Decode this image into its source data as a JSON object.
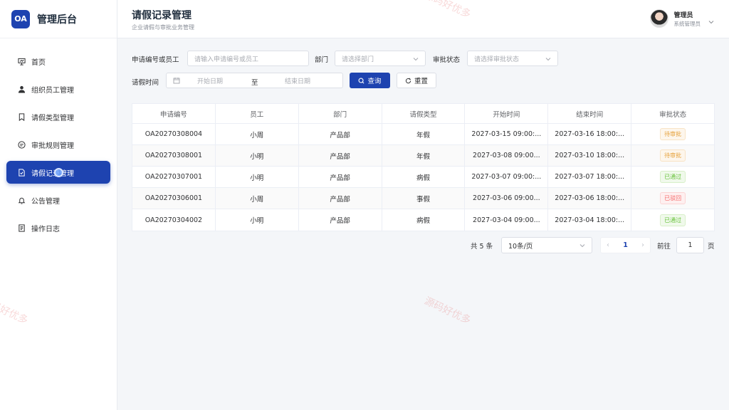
{
  "brand": {
    "logo_text": "OA",
    "name": "管理后台"
  },
  "sidebar": {
    "items": [
      {
        "label": "首页",
        "icon": "presentation-icon",
        "active": false
      },
      {
        "label": "组织员工管理",
        "icon": "user-icon",
        "active": false
      },
      {
        "label": "请假类型管理",
        "icon": "bookmark-icon",
        "active": false
      },
      {
        "label": "审批规则管理",
        "icon": "rules-icon",
        "active": false
      },
      {
        "label": "请假记录管理",
        "icon": "document-icon",
        "active": true
      },
      {
        "label": "公告管理",
        "icon": "bell-icon",
        "active": false
      },
      {
        "label": "操作日志",
        "icon": "log-icon",
        "active": false
      }
    ]
  },
  "header": {
    "title": "请假记录管理",
    "subtitle": "企业请假与审批业务管理",
    "user": {
      "name": "管理员",
      "role": "系统管理员"
    }
  },
  "filters": {
    "keyword_label": "申请编号或员工",
    "keyword_placeholder": "请输入申请编号或员工",
    "dept_label": "部门",
    "dept_placeholder": "请选择部门",
    "status_label": "审批状态",
    "status_placeholder": "请选择审批状态",
    "time_label": "请假时间",
    "start_placeholder": "开始日期",
    "range_sep": "至",
    "end_placeholder": "结束日期",
    "search_button": "查询",
    "reset_button": "重置"
  },
  "table": {
    "columns": [
      "申请编号",
      "员工",
      "部门",
      "请假类型",
      "开始时间",
      "结束时间",
      "审批状态"
    ],
    "rows": [
      {
        "id": "OA20270308004",
        "employee": "小周",
        "dept": "产品部",
        "type": "年假",
        "start": "2027-03-15 09:00:...",
        "end": "2027-03-16 18:00:...",
        "status": "待审批",
        "status_kind": "pending"
      },
      {
        "id": "OA20270308001",
        "employee": "小明",
        "dept": "产品部",
        "type": "年假",
        "start": "2027-03-08 09:00...",
        "end": "2027-03-10 18:00:...",
        "status": "待审批",
        "status_kind": "pending"
      },
      {
        "id": "OA20270307001",
        "employee": "小明",
        "dept": "产品部",
        "type": "病假",
        "start": "2027-03-07 09:00:...",
        "end": "2027-03-07 18:00:...",
        "status": "已通过",
        "status_kind": "approved"
      },
      {
        "id": "OA20270306001",
        "employee": "小周",
        "dept": "产品部",
        "type": "事假",
        "start": "2027-03-06 09:00...",
        "end": "2027-03-06 18:00:...",
        "status": "已驳回",
        "status_kind": "rejected"
      },
      {
        "id": "OA20270304002",
        "employee": "小明",
        "dept": "产品部",
        "type": "病假",
        "start": "2027-03-04 09:00...",
        "end": "2027-03-04 18:00:...",
        "status": "已通过",
        "status_kind": "approved"
      }
    ]
  },
  "pagination": {
    "total": "共 5 条",
    "page_size": "10条/页",
    "current_page": "1",
    "goto_label": "前往",
    "goto_value": "1",
    "goto_unit": "页"
  },
  "watermark_text": "源码好优多",
  "colors": {
    "accent": "#1e43b0",
    "pending": "#e6a23c",
    "approved": "#67c23a",
    "rejected": "#f56c6c"
  }
}
